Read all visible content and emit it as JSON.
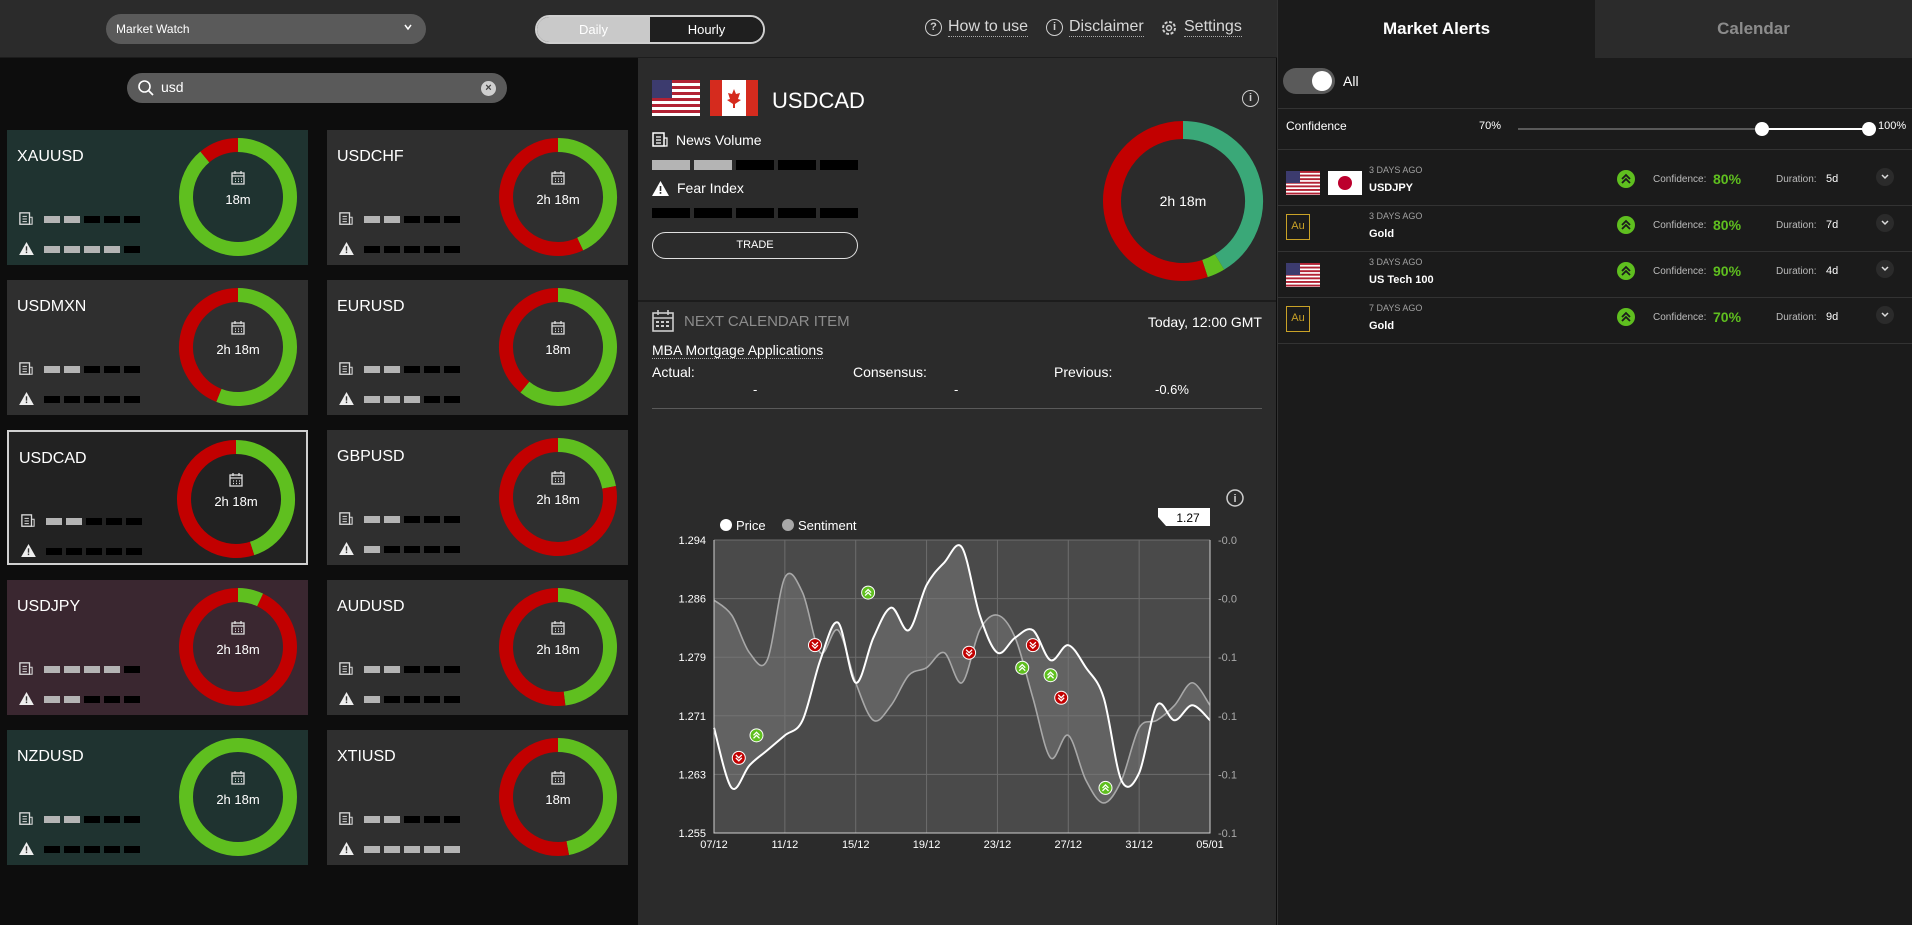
{
  "topbar": {
    "dropdown": "Market Watch",
    "tabs": [
      "Daily",
      "Hourly"
    ],
    "links": [
      "How to use",
      "Disclaimer",
      "Settings"
    ]
  },
  "search": {
    "value": "usd"
  },
  "cards": [
    {
      "name": "XAUUSD",
      "time": "18m",
      "news": 2,
      "fear": 4,
      "green_pct": 89,
      "bg": "#1f3330"
    },
    {
      "name": "USDCHF",
      "time": "2h 18m",
      "news": 2,
      "fear": 0,
      "green_pct": 43,
      "bg": "#2f2f2f"
    },
    {
      "name": "USDMXN",
      "time": "2h 18m",
      "news": 2,
      "fear": 0,
      "green_pct": 56,
      "bg": "#2f2f2f"
    },
    {
      "name": "EURUSD",
      "time": "18m",
      "news": 2,
      "fear": 3,
      "green_pct": 61,
      "bg": "#2f2f2f"
    },
    {
      "name": "USDCAD",
      "time": "2h 18m",
      "news": 2,
      "fear": 0,
      "green_pct": 45,
      "bg": "#222222",
      "selected": true
    },
    {
      "name": "GBPUSD",
      "time": "2h 18m",
      "news": 2,
      "fear": 1,
      "green_pct": 22,
      "bg": "#2f2f2f"
    },
    {
      "name": "USDJPY",
      "time": "2h 18m",
      "news": 4,
      "fear": 2,
      "green_pct": 7,
      "bg": "#3a2730"
    },
    {
      "name": "AUDUSD",
      "time": "2h 18m",
      "news": 2,
      "fear": 1,
      "green_pct": 48,
      "bg": "#2f2f2f"
    },
    {
      "name": "NZDUSD",
      "time": "2h 18m",
      "news": 2,
      "fear": 0,
      "green_pct": 100,
      "bg": "#1f3330"
    },
    {
      "name": "XTIUSD",
      "time": "18m",
      "news": 2,
      "fear": 5,
      "green_pct": 47,
      "bg": "#2f2f2f"
    }
  ],
  "detail": {
    "pair": "USDCAD",
    "news_label": "News Volume",
    "news_level": 2,
    "fear_label": "Fear Index",
    "fear_level": 0,
    "trade_label": "TRADE",
    "donut_time": "2h 18m",
    "donut_green_pct": 45
  },
  "calendar": {
    "heading": "NEXT CALENDAR ITEM",
    "time": "Today, 12:00 GMT",
    "event": "MBA Mortgage Applications",
    "actual_label": "Actual:",
    "actual": "-",
    "consensus_label": "Consensus:",
    "consensus": "-",
    "previous_label": "Previous:",
    "previous": "-0.6%"
  },
  "chart_data": {
    "type": "line",
    "legend": [
      "Price",
      "Sentiment"
    ],
    "current_price_label": "1.27",
    "x_ticks": [
      "07/12",
      "11/12",
      "15/12",
      "19/12",
      "23/12",
      "27/12",
      "31/12",
      "05/01"
    ],
    "y_ticks_left": [
      "1.294",
      "1.286",
      "1.279",
      "1.271",
      "1.263",
      "1.255"
    ],
    "y_ticks_right": [
      "-0.0",
      "-0.0",
      "-0.1",
      "-0.1",
      "-0.1",
      "-0.1"
    ],
    "ylim": [
      1.255,
      1.294
    ],
    "price": [
      [
        0,
        1.269
      ],
      [
        1,
        1.261
      ],
      [
        2,
        1.264
      ],
      [
        3,
        1.266
      ],
      [
        4,
        1.268
      ],
      [
        5,
        1.27
      ],
      [
        6,
        1.278
      ],
      [
        7,
        1.283
      ],
      [
        8,
        1.275
      ],
      [
        9,
        1.281
      ],
      [
        10,
        1.285
      ],
      [
        11,
        1.282
      ],
      [
        12,
        1.288
      ],
      [
        13,
        1.291
      ],
      [
        14,
        1.293
      ],
      [
        15,
        1.284
      ],
      [
        16,
        1.279
      ],
      [
        17,
        1.281
      ],
      [
        18,
        1.282
      ],
      [
        19,
        1.278
      ],
      [
        20,
        1.28
      ],
      [
        21,
        1.277
      ],
      [
        22,
        1.273
      ],
      [
        23,
        1.262
      ],
      [
        24,
        1.263
      ],
      [
        25,
        1.272
      ],
      [
        26,
        1.27
      ],
      [
        27,
        1.272
      ],
      [
        28,
        1.27
      ]
    ],
    "sentiment": [
      [
        0,
        1.286
      ],
      [
        1,
        1.284
      ],
      [
        2,
        1.279
      ],
      [
        3,
        1.278
      ],
      [
        4,
        1.289
      ],
      [
        5,
        1.287
      ],
      [
        6,
        1.279
      ],
      [
        7,
        1.282
      ],
      [
        8,
        1.275
      ],
      [
        9,
        1.27
      ],
      [
        10,
        1.272
      ],
      [
        11,
        1.276
      ],
      [
        12,
        1.277
      ],
      [
        13,
        1.279
      ],
      [
        14,
        1.275
      ],
      [
        15,
        1.282
      ],
      [
        16,
        1.284
      ],
      [
        17,
        1.281
      ],
      [
        18,
        1.273
      ],
      [
        19,
        1.265
      ],
      [
        20,
        1.268
      ],
      [
        21,
        1.262
      ],
      [
        22,
        1.259
      ],
      [
        23,
        1.262
      ],
      [
        24,
        1.269
      ],
      [
        25,
        1.27
      ],
      [
        26,
        1.272
      ],
      [
        27,
        1.275
      ],
      [
        28,
        1.272
      ]
    ],
    "markers": [
      {
        "x": 1.4,
        "y": 1.265,
        "dir": "down"
      },
      {
        "x": 2.4,
        "y": 1.268,
        "dir": "up"
      },
      {
        "x": 5.7,
        "y": 1.28,
        "dir": "down"
      },
      {
        "x": 8.7,
        "y": 1.287,
        "dir": "up"
      },
      {
        "x": 14.4,
        "y": 1.279,
        "dir": "down"
      },
      {
        "x": 17.4,
        "y": 1.277,
        "dir": "up"
      },
      {
        "x": 18.0,
        "y": 1.28,
        "dir": "down"
      },
      {
        "x": 19.0,
        "y": 1.276,
        "dir": "up"
      },
      {
        "x": 19.6,
        "y": 1.273,
        "dir": "down"
      },
      {
        "x": 22.1,
        "y": 1.261,
        "dir": "up"
      }
    ]
  },
  "right": {
    "tabs": [
      "Market Alerts",
      "Calendar"
    ],
    "all_label": "All",
    "confidence_label": "Confidence",
    "conf_min": "70%",
    "conf_max": "100%",
    "alerts": [
      {
        "ago": "3 DAYS AGO",
        "name": "USDJPY",
        "confidence_label": "Confidence:",
        "confidence": "80%",
        "duration_label": "Duration:",
        "duration": "5d",
        "icon": "flag-us-jp"
      },
      {
        "ago": "3 DAYS AGO",
        "name": "Gold",
        "confidence_label": "Confidence:",
        "confidence": "80%",
        "duration_label": "Duration:",
        "duration": "7d",
        "icon": "gold",
        "icon_text": "Au"
      },
      {
        "ago": "3 DAYS AGO",
        "name": "US Tech 100",
        "confidence_label": "Confidence:",
        "confidence": "90%",
        "duration_label": "Duration:",
        "duration": "4d",
        "icon": "flag-us"
      },
      {
        "ago": "7 DAYS AGO",
        "name": "Gold",
        "confidence_label": "Confidence:",
        "confidence": "70%",
        "duration_label": "Duration:",
        "duration": "9d",
        "icon": "gold",
        "icon_text": "Au"
      }
    ]
  },
  "colors": {
    "green": "#5fbf1f",
    "red": "#c20000",
    "teal": "#3aa878"
  }
}
